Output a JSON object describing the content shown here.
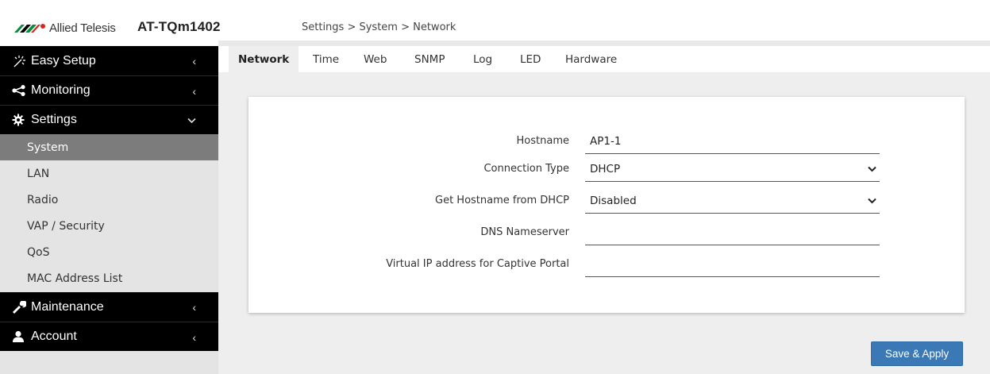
{
  "header": {
    "logo_text": "Allied Telesis",
    "product": "AT-TQm1402",
    "breadcrumb": "Settings > System > Network"
  },
  "sidebar": {
    "sections": [
      {
        "label": "Easy Setup",
        "icon": "magic-wand-icon",
        "chevron": "‹"
      },
      {
        "label": "Monitoring",
        "icon": "share-icon",
        "chevron": "‹"
      },
      {
        "label": "Settings",
        "icon": "gear-icon",
        "chevron": "⌄"
      },
      {
        "label": "Maintenance",
        "icon": "wrench-icon",
        "chevron": "‹"
      },
      {
        "label": "Account",
        "icon": "user-icon",
        "chevron": "‹"
      }
    ],
    "settings_items": [
      "System",
      "LAN",
      "Radio",
      "VAP / Security",
      "QoS",
      "MAC Address List"
    ],
    "active_item": "System"
  },
  "tabs": [
    {
      "label": "Network",
      "active": true
    },
    {
      "label": "Time"
    },
    {
      "label": "Web"
    },
    {
      "label": "SNMP"
    },
    {
      "label": "Log"
    },
    {
      "label": "LED"
    },
    {
      "label": "Hardware"
    }
  ],
  "form": {
    "hostname_label": "Hostname",
    "hostname_value": "AP1-1",
    "connection_type_label": "Connection Type",
    "connection_type_value": "DHCP",
    "get_hostname_label": "Get Hostname from DHCP",
    "get_hostname_value": "Disabled",
    "dns_label": "DNS Nameserver",
    "dns_value": "",
    "virtual_ip_label": "Virtual IP address for Captive Portal",
    "virtual_ip_value": ""
  },
  "actions": {
    "save_label": "Save & Apply"
  },
  "colors": {
    "accent": "#3a78b6",
    "sidebar_section_bg": "#000000",
    "sidebar_bg": "#e4e4e4",
    "active_item_bg": "#7c7c7c",
    "logo_green": "#0d8a3f",
    "logo_red": "#d9251c"
  }
}
